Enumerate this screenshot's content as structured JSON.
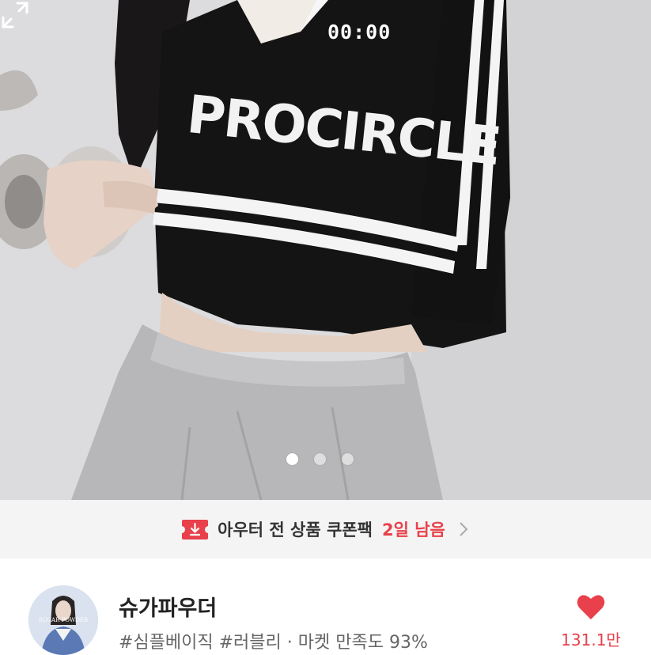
{
  "product_image": {
    "timer": "00:00",
    "shirt_print": "PROCIRCLE",
    "pagination": {
      "total": 3,
      "current": 1
    },
    "expand_icon": "expand-arrows-icon"
  },
  "coupon_banner": {
    "icon": "coupon-download-icon",
    "text": "아우터 전 상품 쿠폰팩",
    "days_left": "2일 남음",
    "chevron": "chevron-right-icon",
    "accent_color": "#e8414b"
  },
  "shop": {
    "name": "슈가파우더",
    "avatar_logo": "SUGAR POWDER",
    "tags": "#심플베이직 #러블리 · 마켓 만족도 93%",
    "likes": "131.1만",
    "heart_icon": "heart-icon",
    "heart_color": "#e8414b"
  }
}
